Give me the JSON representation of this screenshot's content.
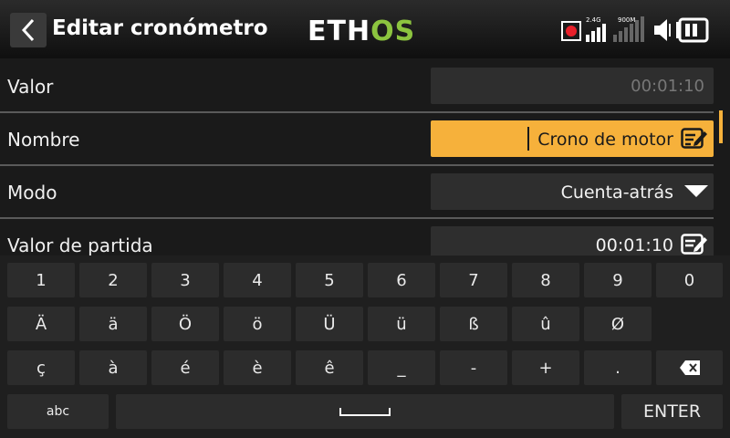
{
  "header": {
    "title": "Editar cronómetro",
    "logo_left": "ETH",
    "logo_right": "OS",
    "signal_label_1": "2.4G",
    "signal_label_2": "900M"
  },
  "form": {
    "rows": [
      {
        "label": "Valor",
        "value": "00:01:10"
      },
      {
        "label": "Nombre",
        "value": "Crono de motor"
      },
      {
        "label": "Modo",
        "value": "Cuenta-atrás"
      },
      {
        "label": "Valor de partida",
        "value": "00:01:10"
      }
    ]
  },
  "keyboard": {
    "row1": [
      "1",
      "2",
      "3",
      "4",
      "5",
      "6",
      "7",
      "8",
      "9",
      "0"
    ],
    "row2": [
      "Ä",
      "ä",
      "Ö",
      "ö",
      "Ü",
      "ü",
      "ß",
      "û",
      "Ø"
    ],
    "row3": [
      "ç",
      "à",
      "é",
      "è",
      "ê",
      "_",
      "-",
      "+",
      "."
    ],
    "abc_label": "abc",
    "enter_label": "ENTER"
  },
  "colors": {
    "accent": "#f6b13b",
    "logo_green": "#8cc43f",
    "record": "#e8202a"
  }
}
